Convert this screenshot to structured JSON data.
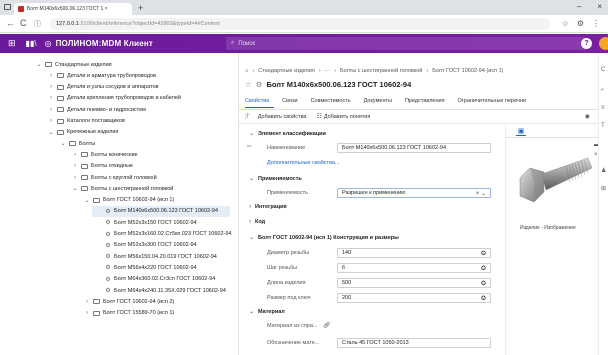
{
  "browser": {
    "tab_title": "Болт М140х6х500.06.123 ГОСТ 1 ×",
    "tab_close": "×",
    "new_tab": "+",
    "url_host": "127.0.0.1",
    "url_path": ":5100/client/reference?objectId=42803&typeId=4#Content",
    "win_min": "–",
    "win_close": "×"
  },
  "app": {
    "brand": "ПОЛИНОМ:MDM Клиент",
    "search_placeholder": "Поиск",
    "help": "?"
  },
  "tree": [
    {
      "label": "Стандартные изделия",
      "indent": 0,
      "chev": "⌄",
      "type": "folder"
    },
    {
      "label": "Детали и арматура трубопроводов",
      "indent": 1,
      "chev": "›",
      "type": "folder"
    },
    {
      "label": "Детали и узлы сосудов и аппаратов",
      "indent": 1,
      "chev": "›",
      "type": "folder"
    },
    {
      "label": "Детали крепления трубопроводов и кабелей",
      "indent": 1,
      "chev": "›",
      "type": "folder"
    },
    {
      "label": "Детали пневмо- и гидросистем",
      "indent": 1,
      "chev": "›",
      "type": "folder"
    },
    {
      "label": "Каталоги поставщиков",
      "indent": 1,
      "chev": "›",
      "type": "folder"
    },
    {
      "label": "Крепежные изделия",
      "indent": 1,
      "chev": "⌄",
      "type": "folder"
    },
    {
      "label": "Болты",
      "indent": 2,
      "chev": "⌄",
      "type": "folder"
    },
    {
      "label": "Болты конические",
      "indent": 3,
      "chev": "›",
      "type": "folder"
    },
    {
      "label": "Болты откидные",
      "indent": 3,
      "chev": "›",
      "type": "folder"
    },
    {
      "label": "Болты с круглой головкой",
      "indent": 3,
      "chev": "›",
      "type": "folder"
    },
    {
      "label": "Болты с шестигранной головкой",
      "indent": 3,
      "chev": "⌄",
      "type": "folder"
    },
    {
      "label": "Болт ГОСТ 10602-94 (исп 1)",
      "indent": 4,
      "chev": "⌄",
      "type": "folder"
    },
    {
      "label": "Болт М140х6х500.06.123 ГОСТ 10602-94",
      "indent": 5,
      "chev": "",
      "type": "item",
      "selected": true
    },
    {
      "label": "Болт М52х3х150 ГОСТ 10602-94",
      "indent": 5,
      "chev": "",
      "type": "item"
    },
    {
      "label": "Болт М52х3х160.02.Ст5кп.023 ГОСТ 10602-94",
      "indent": 5,
      "chev": "",
      "type": "item"
    },
    {
      "label": "Болт М52х3х300 ГОСТ 10602-94",
      "indent": 5,
      "chev": "",
      "type": "item"
    },
    {
      "label": "Болт М56х150.04.20.019 ГОСТ 10602-94",
      "indent": 5,
      "chev": "",
      "type": "item"
    },
    {
      "label": "Болт М56х4х220 ГОСТ 10602-94",
      "indent": 5,
      "chev": "",
      "type": "item"
    },
    {
      "label": "Болт М64х360.02.Ст3сп ГОСТ 10602-94",
      "indent": 5,
      "chev": "",
      "type": "item"
    },
    {
      "label": "Болт М64х4х240.11.35Х.029 ГОСТ 10602-94",
      "indent": 5,
      "chev": "",
      "type": "item"
    },
    {
      "label": "Болт ГОСТ 10602-94 (исп 2)",
      "indent": 4,
      "chev": "›",
      "type": "folder"
    },
    {
      "label": "Болт ГОСТ 15589-70 (исп 1)",
      "indent": 4,
      "chev": "›",
      "type": "folder"
    }
  ],
  "breadcrumb": {
    "home": "⌂",
    "sep": "›",
    "items": [
      "Стандартные изделия",
      "···",
      "Болты с шестигранной головкой",
      "Болт ГОСТ 10602-94 (исп 1)"
    ]
  },
  "page": {
    "star": "☆",
    "gear": "⚙",
    "title": "Болт М140х6х500.06.123 ГОСТ 10602-94"
  },
  "tabs": [
    {
      "label": "Свойства",
      "active": true
    },
    {
      "label": "Связи",
      "active": false
    },
    {
      "label": "Совместимость",
      "active": false
    },
    {
      "label": "Документы",
      "active": false
    },
    {
      "label": "Представления",
      "active": false
    },
    {
      "label": "Ограничительные перечни",
      "active": false
    }
  ],
  "toolbar": {
    "add_property": "Добавить свойства",
    "add_concept": "Добавить понятия"
  },
  "form": {
    "sec_classification": "Элемент классификации",
    "name_label": "Наименование",
    "name_value": "Болт М140х6х500.06.123 ГОСТ 10602-94",
    "additional_link": "Дополнительные свойства...",
    "sec_applicability": "Применяемость",
    "applicability_label": "Применяемость",
    "applicability_value": "Разрешен к применению",
    "sec_integration": "Интеграция",
    "sec_code": "Код",
    "sec_design": "Болт ГОСТ 10602-94 (исп 1) Конструкция и размеры",
    "rows": [
      {
        "label": "Диаметр резьбы",
        "value": "140"
      },
      {
        "label": "Шаг резьбы",
        "value": "6"
      },
      {
        "label": "Длина изделия",
        "value": "500"
      },
      {
        "label": "Размер под ключ",
        "value": "200"
      }
    ],
    "sec_material": "Материал",
    "material_label": "Материал из спра...",
    "material_value": "",
    "designation_label": "Обозначение мате...",
    "designation_value": "Сталь 45 ГОСТ 1050-2013"
  },
  "preview": {
    "caption": "Изделие - Изображение"
  }
}
